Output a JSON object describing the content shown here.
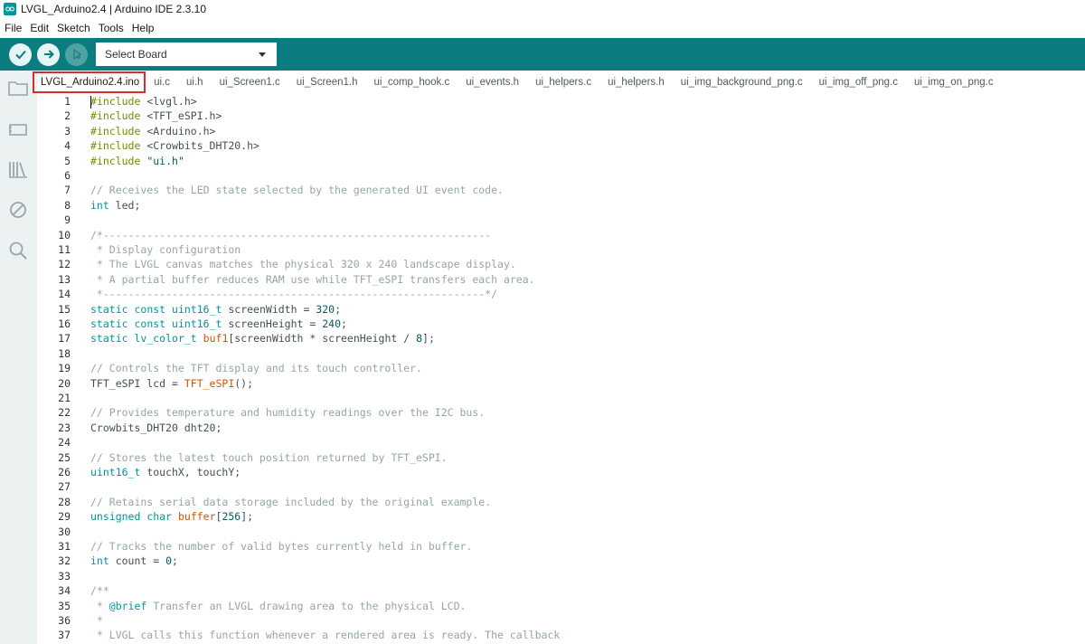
{
  "window": {
    "title": "LVGL_Arduino2.4 | Arduino IDE 2.3.10"
  },
  "menu": [
    "File",
    "Edit",
    "Sketch",
    "Tools",
    "Help"
  ],
  "toolbar": {
    "verify_icon": "check-icon",
    "upload_icon": "arrow-right-icon",
    "debug_icon": "debug-icon",
    "board_select": "Select Board"
  },
  "sidebar": {
    "icons": [
      "folder-icon",
      "board-icon",
      "library-icon",
      "block-icon",
      "search-icon"
    ]
  },
  "tabs": [
    "LVGL_Arduino2.4.ino",
    "ui.c",
    "ui.h",
    "ui_Screen1.c",
    "ui_Screen1.h",
    "ui_comp_hook.c",
    "ui_events.h",
    "ui_helpers.c",
    "ui_helpers.h",
    "ui_img_background_png.c",
    "ui_img_off_png.c",
    "ui_img_on_png.c"
  ],
  "active_tab": 0,
  "code_lines": [
    "#include <lvgl.h>",
    "#include <TFT_eSPI.h>",
    "#include <Arduino.h>",
    "#include <Crowbits_DHT20.h>",
    "#include \"ui.h\"",
    "",
    "// Receives the LED state selected by the generated UI event code.",
    "int led;",
    "",
    "/*--------------------------------------------------------------",
    " * Display configuration",
    " * The LVGL canvas matches the physical 320 x 240 landscape display.",
    " * A partial buffer reduces RAM use while TFT_eSPI transfers each area.",
    " *-------------------------------------------------------------*/",
    "static const uint16_t screenWidth = 320;",
    "static const uint16_t screenHeight = 240;",
    "static lv_color_t buf1[screenWidth * screenHeight / 8];",
    "",
    "// Controls the TFT display and its touch controller.",
    "TFT_eSPI lcd = TFT_eSPI();",
    "",
    "// Provides temperature and humidity readings over the I2C bus.",
    "Crowbits_DHT20 dht20;",
    "",
    "// Stores the latest touch position returned by TFT_eSPI.",
    "uint16_t touchX, touchY;",
    "",
    "// Retains serial data storage included by the original example.",
    "unsigned char buffer[256];",
    "",
    "// Tracks the number of valid bytes currently held in buffer.",
    "int count = 0;",
    "",
    "/**",
    " * @brief Transfer an LVGL drawing area to the physical LCD.",
    " *",
    " * LVGL calls this function whenever a rendered area is ready. The callback"
  ],
  "colors": {
    "toolbar_bg": "#0b7d80",
    "sidebar_bg": "#ecf1f1",
    "active_tab_outline": "#d32f2f",
    "keyword": "#00979d",
    "preprocessor": "#728e00",
    "comment": "#95a5a6",
    "function": "#d35400"
  }
}
